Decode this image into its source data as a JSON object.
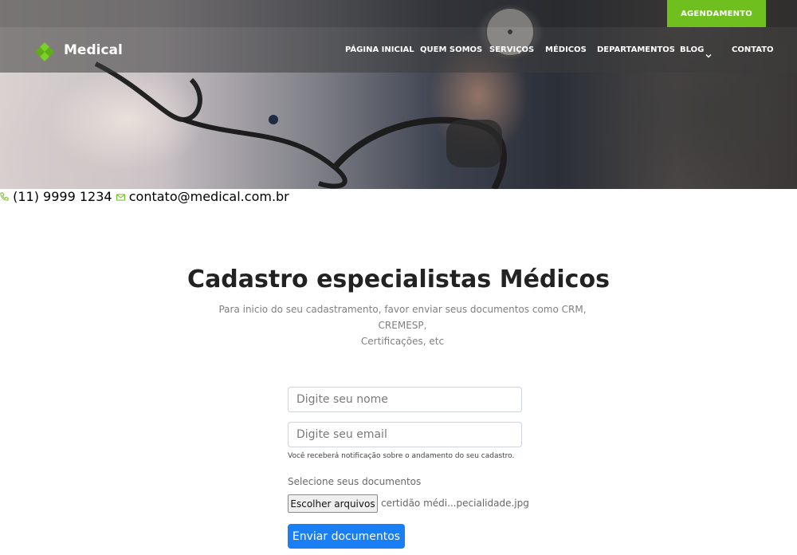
{
  "topbar": {
    "phone": "(11) 9999 1234",
    "email": "contato@medical.com.br",
    "cta_label": "AGENDAMENTO",
    "phone_icon": "phone-icon",
    "email_icon": "mail-icon"
  },
  "brand": {
    "name": "Medical",
    "logo_icon": "medical-cross-logo-icon",
    "accent_color": "#6fbf1f"
  },
  "nav": {
    "items": [
      {
        "label": "PÁGINA INICIAL"
      },
      {
        "label": "QUEM SOMOS"
      },
      {
        "label": "SERVIÇOS"
      },
      {
        "label": "MÉDICOS"
      },
      {
        "label": "DEPARTAMENTOS"
      },
      {
        "label": "BLOG"
      },
      {
        "label": "CONTATO"
      }
    ],
    "blog_dropdown_icon": "chevron-down-icon"
  },
  "main": {
    "title": "Cadastro especialistas Médicos",
    "subtitle_line1": "Para inicio do seu cadastramento, favor enviar seus documentos como CRM, CREMESP,",
    "subtitle_line2": "Certificações, etc"
  },
  "form": {
    "name_placeholder": "Digite seu nome",
    "email_placeholder": "Digite seu email",
    "email_help": "Você receberá notificação sobre o andamento do seu cadastro.",
    "files_label": "Selecione seus documentos",
    "file_button": "Escolher arquivos",
    "file_name": "certidão médi...pecialidade.jpg",
    "submit_label": "Enviar documentos",
    "submit_color": "#1a7ff5"
  }
}
